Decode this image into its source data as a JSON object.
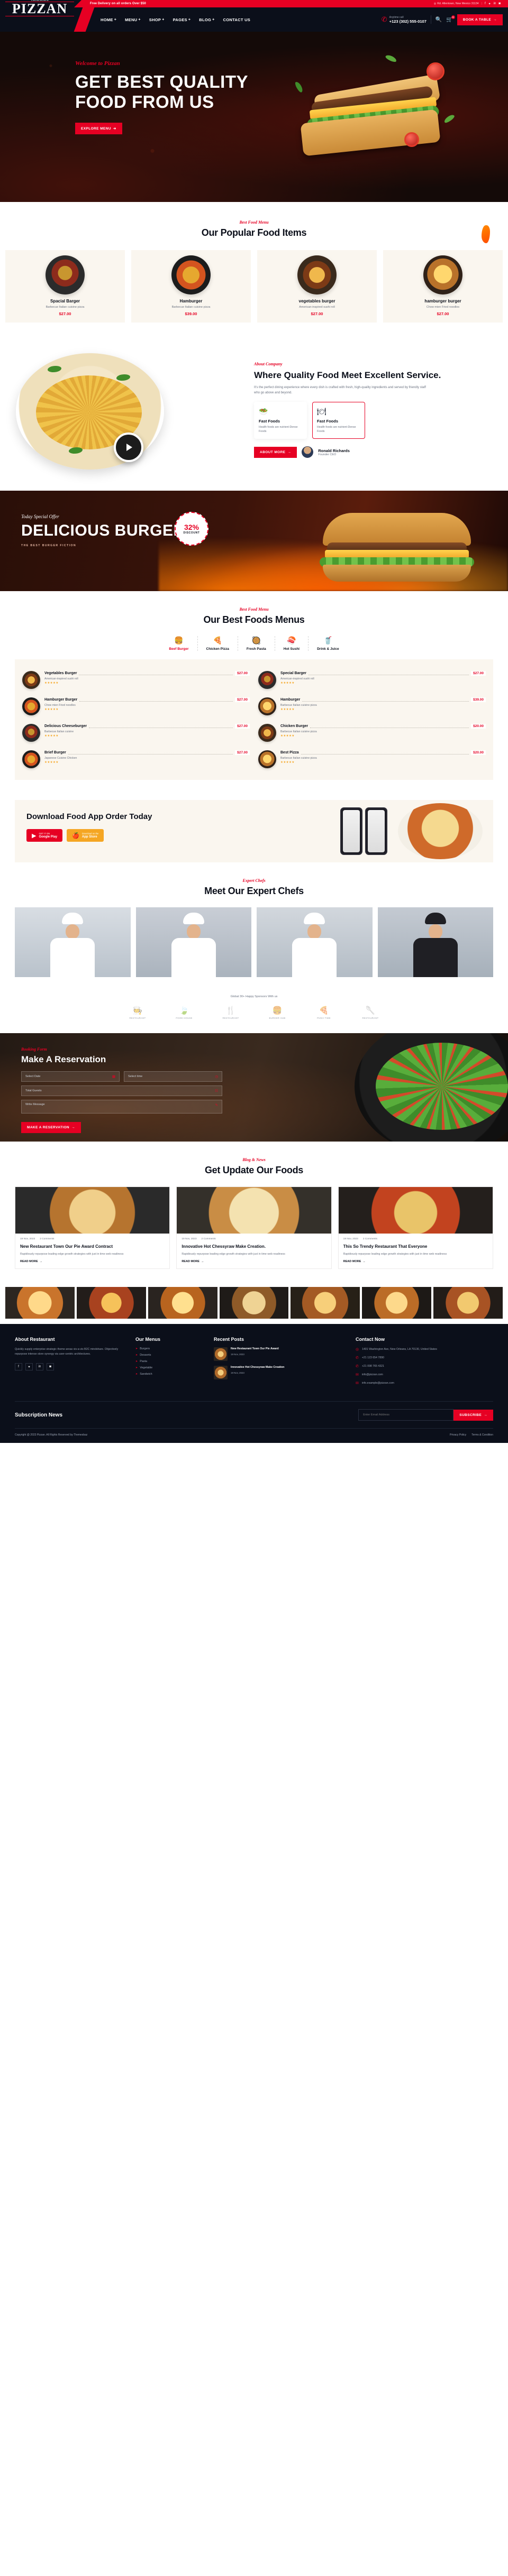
{
  "topbar": {
    "promo": "Free Delivery on all orders Over $50",
    "address": "Rd. Allentown, New Mexico 31134",
    "address_icon": "location-pin-icon",
    "socials": [
      "facebook-icon",
      "twitter-icon",
      "linkedin-icon",
      "instagram-icon"
    ]
  },
  "brand": {
    "name": "PIZZAN",
    "mark": "fork-in-circle-icon"
  },
  "nav": {
    "items": [
      {
        "label": "HOME",
        "caret": "+"
      },
      {
        "label": "MENU",
        "caret": "+"
      },
      {
        "label": "SHOP",
        "caret": "+"
      },
      {
        "label": "PAGES",
        "caret": "+"
      },
      {
        "label": "BLOG",
        "caret": "+"
      },
      {
        "label": "CONTACT US",
        "caret": ""
      }
    ],
    "call_label": "Anytime call",
    "call_number": "+123 (302) 555-0107",
    "cart_count": "0",
    "book_button": "BOOK A TABLE"
  },
  "hero": {
    "welcome": "Welcome to Pizzan",
    "title": "GET BEST QUALITY FOOD FROM US",
    "cta": "EXPLORE MENU"
  },
  "popular": {
    "subtitle": "Best Food Menu",
    "title": "Our Popular Food Items",
    "items": [
      {
        "name": "Spacial Barger",
        "desc": "Barbecue Italian cuisine pizza",
        "price": "$27.00"
      },
      {
        "name": "Hamburger",
        "desc": "Barbecue Italian cuisine pizza",
        "price": "$39.00"
      },
      {
        "name": "vegetables burger",
        "desc": "American-inspired sushi roll",
        "price": "$27.00"
      },
      {
        "name": "hamburger burger",
        "desc": "Chow mien Fried noodles",
        "price": "$27.00"
      }
    ]
  },
  "about": {
    "subtitle": "About Company",
    "title": "Where Quality Food Meet Excellent Service.",
    "text": "It's the perfect dining experience where every dish is crafted with fresh, high-quality ingredients and served by friendly staff who go above and beyond.",
    "features": [
      {
        "icon": "healthy-plate-icon",
        "name": "Fast Foods",
        "desc": "Health foods are nutrient-Dense Foods"
      },
      {
        "icon": "fork-plate-icon",
        "name": "Fast Foods",
        "desc": "Health foods are nutrient-Dense Foods"
      }
    ],
    "cta": "ABOUT MORE",
    "ceo_name": "Ronald Richards",
    "ceo_role": "Founder CEO",
    "play_icon": "play-button-icon"
  },
  "offer": {
    "subtitle": "Today Special Offer",
    "title": "DELICIOUS BURGER",
    "note": "THE BEST BURGER FICTION",
    "discount_percent": "32%",
    "discount_label": "DISCOUNT"
  },
  "menus": {
    "subtitle": "Best Food Menu",
    "title": "Our Best Foods Menus",
    "tabs": [
      {
        "icon": "burger-icon",
        "label": "Beef Burger",
        "active": true
      },
      {
        "icon": "pizza-icon",
        "label": "Chicken Pizza",
        "active": false
      },
      {
        "icon": "pasta-icon",
        "label": "Fresh Pasta",
        "active": false
      },
      {
        "icon": "sushi-icon",
        "label": "Hot Sushi",
        "active": false
      },
      {
        "icon": "drink-icon",
        "label": "Drink & Juice",
        "active": false
      }
    ],
    "items": [
      {
        "name": "Vegetables Burger",
        "price": "$27.00",
        "desc": "American-inspired sushi roll",
        "stars": "★★★★★"
      },
      {
        "name": "Special Barger",
        "price": "$27.00",
        "desc": "American-inspired sushi roll",
        "stars": "★★★★★"
      },
      {
        "name": "Hamburger Burger",
        "price": "$27.00",
        "desc": "Chow mien Fried noodles",
        "stars": "★★★★★"
      },
      {
        "name": "Hamburger",
        "price": "$39.00",
        "desc": "Barbecue Italian cuisine pizza",
        "stars": "★★★★★"
      },
      {
        "name": "Delicious Cheeseburger",
        "price": "$27.00",
        "desc": "Barbecue Italian cuisine",
        "stars": "★★★★★"
      },
      {
        "name": "Chicken Burger",
        "price": "$20.00",
        "desc": "Barbecue Italian cuisine pizza",
        "stars": "★★★★★"
      },
      {
        "name": "Brief Burger",
        "price": "$27.00",
        "desc": "Japanese Cuisine Chicken",
        "stars": "★★★★★"
      },
      {
        "name": "Best Pizza",
        "price": "$20.00",
        "desc": "Barbecue Italian cuisine pizza",
        "stars": "★★★★★"
      }
    ]
  },
  "app": {
    "title": "Download Food App Order Today",
    "stores": [
      {
        "icon": "play-triangle-icon",
        "top": "GET IT ON",
        "name": "Google Play"
      },
      {
        "icon": "apple-icon",
        "top": "Download on the",
        "name": "App Store"
      }
    ]
  },
  "chefs": {
    "subtitle": "Expert Chefs",
    "title": "Meet Our Expert Chefs",
    "members": [
      "chef-one",
      "chef-two",
      "chef-three",
      "chef-four"
    ]
  },
  "sponsors": {
    "label": "Global 30+ Happy Sponsors With us",
    "items": [
      {
        "glyph": "🧑‍🍳",
        "name": "RESTAURANT"
      },
      {
        "glyph": "🍃",
        "name": "FOOD HOUSE"
      },
      {
        "glyph": "🍴",
        "name": "RESTAURANT"
      },
      {
        "glyph": "🍔",
        "name": "BURGER HUB"
      },
      {
        "glyph": "🍕",
        "name": "PIZZA TIME"
      },
      {
        "glyph": "🥄",
        "name": "RESTAURANT"
      }
    ]
  },
  "reservation": {
    "subtitle": "Booking Form",
    "title": "Make A Reservation",
    "fields": [
      {
        "placeholder": "Select Date",
        "icon": "calendar-icon"
      },
      {
        "placeholder": "Select time",
        "icon": "clock-icon"
      },
      {
        "placeholder": "Total Guests",
        "icon": "users-icon"
      },
      {
        "placeholder": "Write Message",
        "icon": "pencil-icon"
      }
    ],
    "cta": "MAKE A RESERVATION"
  },
  "blog": {
    "subtitle": "Blog & News",
    "title": "Get Update Our Foods",
    "posts": [
      {
        "date": "19 Nov, 2023",
        "comments": "2 Comments",
        "title": "New Restaurant Town Our Pie Award Contract",
        "desc": "Rapidiously repurpose leading edge growth strategies with just in time web readiness",
        "more": "READ MORE"
      },
      {
        "date": "19 Nov, 2023",
        "comments": "2 Comments",
        "title": "Innovative Hot Chessyraw Make Creation.",
        "desc": "Rapidiously repurpose leading edge growth strategies with just in time web readiness",
        "more": "READ MORE"
      },
      {
        "date": "19 Nov, 2023",
        "comments": "2 Comments",
        "title": "This So Trendy Restaurant That Everyone",
        "desc": "Rapidiously repurpose leading edge growth strategies with just in time web readiness",
        "more": "READ MORE"
      }
    ]
  },
  "gallery": {
    "count": 7
  },
  "footer": {
    "about": {
      "heading": "About Restaurant",
      "text": "Quickly supply enterprise strategic theme areas vis-a-vis B2C mindshare. Objectively repurpose intense store synergy via user-centric architectures.",
      "socials": [
        "facebook-icon",
        "twitter-icon",
        "linkedin-icon",
        "instagram-icon"
      ]
    },
    "menus": {
      "heading": "Our Menus",
      "items": [
        "Burgers",
        "Desserts",
        "Pasta",
        "Vegetable",
        "Sandwich"
      ]
    },
    "posts": {
      "heading": "Recent Posts",
      "items": [
        {
          "title": "New Restaurant Town Our Pie Award",
          "date": "19 Nov, 2023"
        },
        {
          "title": "Innovative Hot Chessyraw Make Creation",
          "date": "19 Nov, 2023"
        }
      ]
    },
    "contact": {
      "heading": "Contact Now",
      "items": [
        {
          "icon": "location-pin-icon",
          "text": "1401 Washington Ave, New Orleans, LA 70130, United States"
        },
        {
          "icon": "phone-icon",
          "text": "+21 123 654 7890"
        },
        {
          "icon": "phone-icon",
          "text": "+21 098 765 4321"
        },
        {
          "icon": "mail-icon",
          "text": "info@pizzan.com"
        },
        {
          "icon": "mail-icon",
          "text": "info.example@pizzan.com"
        }
      ]
    },
    "newsletter": {
      "title": "Subscription News",
      "placeholder": "Enter Email Address",
      "button": "SUBSCRIBE"
    },
    "copyright": "Copyright @ 2023 Pizzan. All Rights Reserved by Themesbaz",
    "links": [
      "Privacy Policy",
      "Terms & Condition"
    ]
  }
}
